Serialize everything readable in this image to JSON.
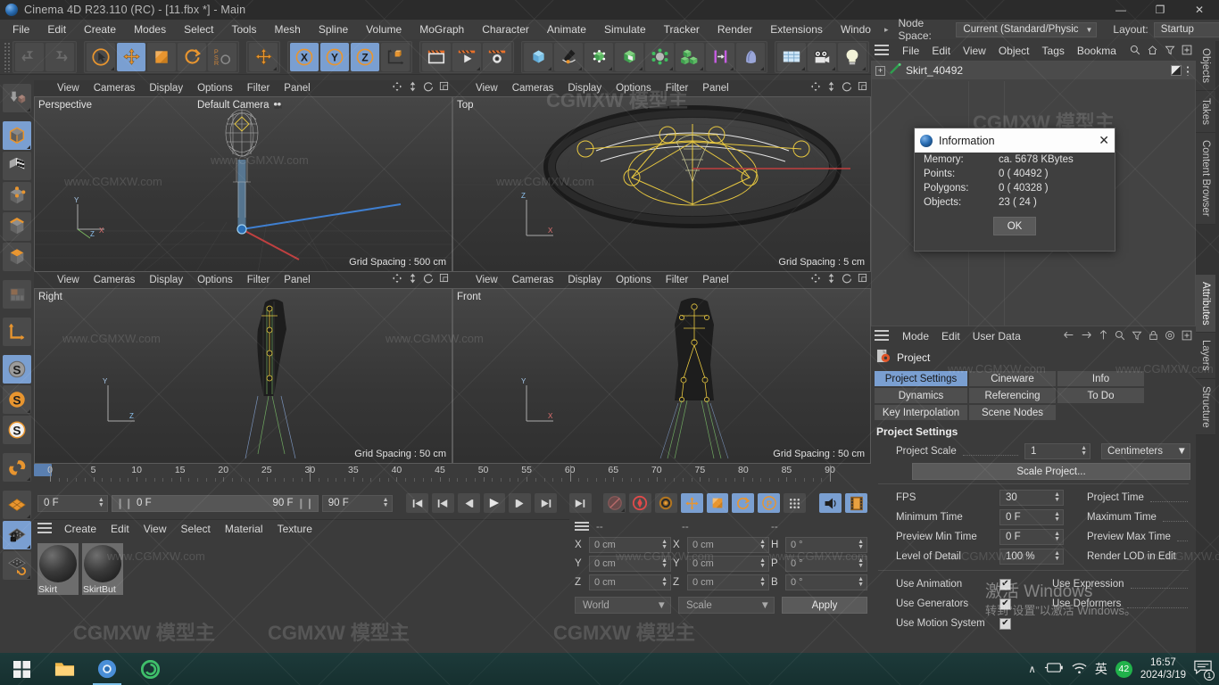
{
  "window": {
    "title": "Cinema 4D R23.110 (RC) - [11.fbx *] - Main",
    "minimize": "—",
    "maximize": "❐",
    "close": "✕"
  },
  "menubar": {
    "items": [
      "File",
      "Edit",
      "Create",
      "Modes",
      "Select",
      "Tools",
      "Mesh",
      "Spline",
      "Volume",
      "MoGraph",
      "Character",
      "Animate",
      "Simulate",
      "Tracker",
      "Render",
      "Extensions",
      "Windo"
    ],
    "overflow_arrow": "▸",
    "node_space_label": "Node Space:",
    "node_space_value": "Current (Standard/Physical)",
    "layout_label": "Layout:",
    "layout_value": "Startup",
    "search_icon": "search-icon"
  },
  "toolbar": {
    "groups": [
      {
        "name": "undo-redo",
        "buttons": [
          {
            "name": "undo-button",
            "icon": "undo-icon",
            "selected": false,
            "corner": false
          },
          {
            "name": "redo-button",
            "icon": "redo-icon",
            "selected": false,
            "corner": false
          }
        ]
      },
      {
        "name": "selection-transform",
        "buttons": [
          {
            "name": "live-selection-button",
            "icon": "cursor-circle-icon",
            "selected": false,
            "corner": true
          },
          {
            "name": "move-button",
            "icon": "move-icon",
            "selected": true,
            "corner": false
          },
          {
            "name": "scale-button",
            "icon": "scale-icon",
            "selected": false,
            "corner": false
          },
          {
            "name": "rotate-button",
            "icon": "rotate-icon",
            "selected": false,
            "corner": false
          },
          {
            "name": "psr-button",
            "icon": "psr-icon",
            "selected": false,
            "corner": false
          }
        ]
      },
      {
        "name": "move-duplicate",
        "buttons": [
          {
            "name": "move-tool-button",
            "icon": "move-icon",
            "selected": false,
            "corner": true
          }
        ]
      },
      {
        "name": "axis-locks",
        "buttons": [
          {
            "name": "lock-x-button",
            "icon": "x-axis-icon",
            "selected": true,
            "corner": false
          },
          {
            "name": "lock-y-button",
            "icon": "y-axis-icon",
            "selected": true,
            "corner": false
          },
          {
            "name": "lock-z-button",
            "icon": "z-axis-icon",
            "selected": true,
            "corner": false
          },
          {
            "name": "world-object-coord-button",
            "icon": "world-coord-icon",
            "selected": false,
            "corner": false
          }
        ]
      },
      {
        "name": "render",
        "buttons": [
          {
            "name": "render-view-button",
            "icon": "render-view-icon",
            "selected": false,
            "corner": false
          },
          {
            "name": "render-to-picture-viewer-button",
            "icon": "render-picture-icon",
            "selected": false,
            "corner": true
          },
          {
            "name": "render-settings-button",
            "icon": "render-settings-icon",
            "selected": false,
            "corner": false
          }
        ]
      },
      {
        "name": "objects",
        "buttons": [
          {
            "name": "add-cube-button",
            "icon": "cube-icon",
            "selected": false,
            "corner": true
          },
          {
            "name": "add-spline-button",
            "icon": "pen-spline-icon",
            "selected": false,
            "corner": true
          },
          {
            "name": "add-generator-button",
            "icon": "generator-icon",
            "selected": false,
            "corner": true
          },
          {
            "name": "add-subdivision-button",
            "icon": "subdivision-icon",
            "selected": false,
            "corner": true
          },
          {
            "name": "add-mograph-button",
            "icon": "mograph-icon",
            "selected": false,
            "corner": true
          },
          {
            "name": "add-array-button",
            "icon": "array-cubes-icon",
            "selected": false,
            "corner": true
          },
          {
            "name": "add-deformer-button",
            "icon": "deformer-icon",
            "selected": false,
            "corner": true
          },
          {
            "name": "add-field-button",
            "icon": "field-icon",
            "selected": false,
            "corner": true
          }
        ]
      },
      {
        "name": "scene",
        "buttons": [
          {
            "name": "add-floor-button",
            "icon": "floor-grid-icon",
            "selected": false,
            "corner": true
          },
          {
            "name": "add-camera-button",
            "icon": "camera-icon",
            "selected": false,
            "corner": true
          },
          {
            "name": "add-light-button",
            "icon": "light-bulb-icon",
            "selected": false,
            "corner": true
          }
        ]
      }
    ]
  },
  "left_tools": [
    {
      "name": "make-editable-button",
      "icon": "make-editable-icon",
      "selected": false,
      "corner": true
    },
    {
      "name": "model-mode-button",
      "icon": "model-cube-icon",
      "selected": true,
      "corner": true
    },
    {
      "name": "texture-mode-button",
      "icon": "texture-checker-icon",
      "selected": false,
      "corner": false
    },
    {
      "name": "points-mode-button",
      "icon": "points-cube-icon",
      "selected": false,
      "corner": false
    },
    {
      "name": "edges-mode-button",
      "icon": "edges-cube-icon",
      "selected": false,
      "corner": false
    },
    {
      "name": "polygons-mode-button",
      "icon": "polygons-cube-icon",
      "selected": false,
      "corner": false
    },
    {
      "name": "uv-mode-button",
      "icon": "uv-mesh-icon",
      "selected": false,
      "corner": false
    },
    {
      "name": "axis-mode-button",
      "icon": "axis-arrows-icon",
      "selected": false,
      "corner": false
    },
    {
      "name": "workplane-button",
      "icon": "workplane-icon",
      "selected": true,
      "corner": false
    },
    {
      "name": "snap-enable-button",
      "icon": "snap-s-grey-icon",
      "selected": true,
      "corner": false
    },
    {
      "name": "snap-quantize-button",
      "icon": "snap-s-orange-icon",
      "selected": false,
      "corner": true
    },
    {
      "name": "snap-settings-button",
      "icon": "snap-s-white-icon",
      "selected": false,
      "corner": false
    },
    {
      "name": "magnet-button",
      "icon": "magnet-icon",
      "selected": false,
      "corner": true
    },
    {
      "name": "workplane-grid-button",
      "icon": "grid-orange-icon",
      "selected": false,
      "corner": true
    },
    {
      "name": "workplane-lock-button",
      "icon": "grid-lock-icon",
      "selected": true,
      "corner": true
    },
    {
      "name": "workplane-align-button",
      "icon": "grid-rotate-icon",
      "selected": false,
      "corner": true
    }
  ],
  "viewports": [
    {
      "name": "perspective-viewport",
      "menus": [
        "View",
        "Cameras",
        "Display",
        "Options",
        "Filter",
        "Panel"
      ],
      "label": "Perspective",
      "camera": "Default Camera",
      "grid_spacing": "Grid Spacing : 500 cm"
    },
    {
      "name": "top-viewport",
      "menus": [
        "View",
        "Cameras",
        "Display",
        "Options",
        "Filter",
        "Panel"
      ],
      "label": "Top",
      "camera": "",
      "grid_spacing": "Grid Spacing : 5 cm"
    },
    {
      "name": "right-viewport",
      "menus": [
        "View",
        "Cameras",
        "Display",
        "Options",
        "Filter",
        "Panel"
      ],
      "label": "Right",
      "camera": "",
      "grid_spacing": "Grid Spacing : 50 cm"
    },
    {
      "name": "front-viewport",
      "menus": [
        "View",
        "Cameras",
        "Display",
        "Options",
        "Filter",
        "Panel"
      ],
      "label": "Front",
      "camera": "",
      "grid_spacing": "Grid Spacing : 50 cm"
    }
  ],
  "timeline": {
    "ticks": [
      0,
      5,
      10,
      15,
      20,
      25,
      30,
      35,
      40,
      45,
      50,
      55,
      60,
      65,
      70,
      75,
      80,
      85,
      90
    ],
    "current_frame": "0 F",
    "range_start": "0 F",
    "range_end": "90 F",
    "end_frame": "90 F",
    "preview_frame": "0 F",
    "transport": [
      {
        "name": "go-to-start-button",
        "icon": "skip-start-icon",
        "on": false
      },
      {
        "name": "go-to-previous-key-button",
        "icon": "prev-key-icon",
        "on": false
      },
      {
        "name": "step-back-button",
        "icon": "step-back-icon",
        "on": false
      },
      {
        "name": "play-button",
        "icon": "play-icon",
        "on": false
      },
      {
        "name": "step-forward-button",
        "icon": "step-forward-icon",
        "on": false
      },
      {
        "name": "go-to-next-key-button",
        "icon": "next-key-icon",
        "on": false
      },
      {
        "name": "go-to-end-button",
        "icon": "skip-end-icon",
        "on": false
      },
      {
        "name": "record-active-objects-button",
        "icon": "record-disabled-icon",
        "on": false
      },
      {
        "name": "autokeying-button",
        "icon": "autokey-icon",
        "on": false
      },
      {
        "name": "keyframe-selection-button",
        "icon": "keyframe-gear-icon",
        "on": false
      },
      {
        "name": "position-key-button",
        "icon": "position-key-icon",
        "on": true
      },
      {
        "name": "scale-key-button",
        "icon": "scale-key-icon",
        "on": true
      },
      {
        "name": "rotation-key-button",
        "icon": "rotation-key-icon",
        "on": true
      },
      {
        "name": "parameter-key-button",
        "icon": "parameter-key-icon",
        "on": true
      },
      {
        "name": "point-level-animation-button",
        "icon": "pla-dots-icon",
        "on": false
      },
      {
        "name": "sound-button",
        "icon": "sound-icon",
        "on": true
      },
      {
        "name": "filmstrip-button",
        "icon": "filmstrip-icon",
        "on": true
      }
    ]
  },
  "material_manager": {
    "menus": [
      "Create",
      "Edit",
      "View",
      "Select",
      "Material",
      "Texture"
    ],
    "materials": [
      {
        "name": "Skirt"
      },
      {
        "name": "SkirtBut"
      }
    ]
  },
  "coordinate_manager": {
    "headers": [
      "--",
      "--",
      "--"
    ],
    "rows": [
      {
        "axis": "X",
        "position": "0 cm",
        "size": "0 cm",
        "rot_label": "H",
        "rotation": "0 °"
      },
      {
        "axis": "Y",
        "position": "0 cm",
        "size": "0 cm",
        "rot_label": "P",
        "rotation": "0 °"
      },
      {
        "axis": "Z",
        "position": "0 cm",
        "size": "0 cm",
        "rot_label": "B",
        "rotation": "0 °"
      }
    ],
    "coord_system": "World",
    "mode": "Scale",
    "apply_label": "Apply"
  },
  "object_manager": {
    "menus": [
      "File",
      "Edit",
      "View",
      "Object",
      "Tags",
      "Bookma"
    ],
    "icons": [
      "search-icon",
      "home-icon",
      "filter-icon",
      "plus-icon"
    ],
    "objects": [
      {
        "name": "Skirt_40492",
        "icon": "spline-object-icon",
        "expandable": "+"
      }
    ]
  },
  "attribute_manager": {
    "menus": [
      "Mode",
      "Edit",
      "User Data"
    ],
    "icons": [
      "back-arrow-icon",
      "forward-arrow-icon",
      "up-arrow-icon",
      "search-icon",
      "filter-icon",
      "lock-icon",
      "target-icon",
      "plus-icon"
    ],
    "object_title": "Project",
    "tabs": [
      {
        "label": "Project Settings",
        "selected": true
      },
      {
        "label": "Cineware",
        "selected": false
      },
      {
        "label": "Info",
        "selected": false
      },
      {
        "label": "Dynamics",
        "selected": false
      },
      {
        "label": "Referencing",
        "selected": false
      },
      {
        "label": "To Do",
        "selected": false
      },
      {
        "label": "Key Interpolation",
        "selected": false
      },
      {
        "label": "Scene Nodes",
        "selected": false
      }
    ],
    "section_title": "Project Settings",
    "project_scale_label": "Project Scale",
    "project_scale_value": "1",
    "project_scale_unit": "Centimeters",
    "scale_project_button": "Scale Project...",
    "fields": [
      {
        "label": "FPS",
        "value": "30",
        "right_label": "Project Time"
      },
      {
        "label": "Minimum Time",
        "value": "0 F",
        "right_label": "Maximum Time"
      },
      {
        "label": "Preview Min Time",
        "value": "0 F",
        "right_label": "Preview Max Time"
      },
      {
        "label": "Level of Detail",
        "value": "100 %",
        "right_label": "Render LOD in Edit"
      }
    ],
    "checkboxes": [
      {
        "label": "Use Animation",
        "checked": true,
        "right_label": "Use Expression",
        "right_checked": false
      },
      {
        "label": "Use Generators",
        "checked": true,
        "right_label": "Use Deformers",
        "right_checked": false
      },
      {
        "label": "Use Motion System",
        "checked": true,
        "right_label": "",
        "right_checked": false
      }
    ]
  },
  "vertical_tabs_right": [
    {
      "label": "Objects",
      "selected": false
    },
    {
      "label": "Takes",
      "selected": false
    },
    {
      "label": "Content Browser",
      "selected": false
    },
    {
      "label": "Attributes",
      "selected": true
    },
    {
      "label": "Layers",
      "selected": false
    },
    {
      "label": "Structure",
      "selected": false
    }
  ],
  "information_dialog": {
    "title": "Information",
    "close": "✕",
    "rows": [
      {
        "key": "Memory:",
        "value": "ca. 5678 KBytes"
      },
      {
        "key": "Points:",
        "value": "0 ( 40492 )"
      },
      {
        "key": "Polygons:",
        "value": "0 ( 40328 )"
      },
      {
        "key": "Objects:",
        "value": "23 ( 24 )"
      }
    ],
    "ok_label": "OK"
  },
  "taskbar": {
    "start_icon": "windows-start-icon",
    "apps": [
      {
        "name": "file-explorer-icon",
        "active": false
      },
      {
        "name": "chrome-icon",
        "active": true
      },
      {
        "name": "browser-icon",
        "active": false
      }
    ],
    "tray": {
      "chevron": "∧",
      "battery_icon": "battery-icon",
      "wifi_icon": "wifi-icon",
      "ime": "英",
      "badge": "42",
      "time": "16:57",
      "date": "2024/3/19",
      "notification_count": "1"
    }
  },
  "watermarks": {
    "text": "www.CGMXW.com",
    "logo": "CGMXW 模型主",
    "windows_activate_line1": "激活 Windows",
    "windows_activate_line2": "转到“设置”以激活 Windows。"
  }
}
